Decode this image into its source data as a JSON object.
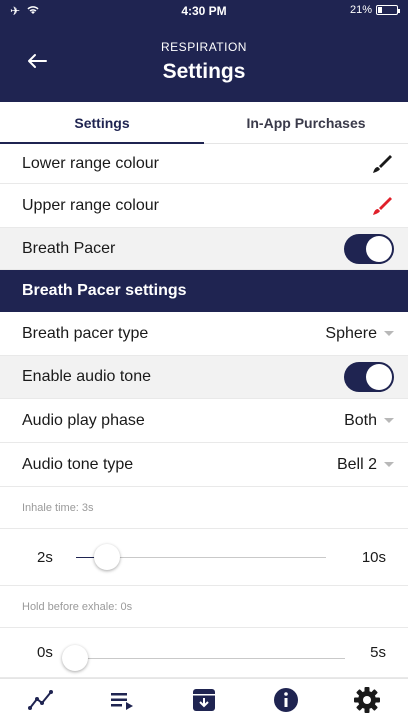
{
  "status_bar": {
    "icons": "✈ ︎",
    "time": "4:30 PM",
    "battery": "21%"
  },
  "header": {
    "subtitle": "RESPIRATION",
    "title": "Settings"
  },
  "tabs": [
    {
      "label": "Settings",
      "active": true
    },
    {
      "label": "In-App Purchases",
      "active": false
    }
  ],
  "settings": {
    "lower_range_colour": {
      "label": "Lower range colour",
      "color": "#1a1a1a"
    },
    "upper_range_colour": {
      "label": "Upper range colour",
      "color": "#e0202a"
    },
    "breath_pacer": {
      "label": "Breath Pacer",
      "on": true
    }
  },
  "pacer_section": {
    "title": "Breath Pacer settings",
    "pacer_type": {
      "label": "Breath pacer type",
      "value": "Sphere"
    },
    "audio_tone": {
      "label": "Enable audio tone",
      "on": true
    },
    "audio_phase": {
      "label": "Audio play phase",
      "value": "Both"
    },
    "tone_type": {
      "label": "Audio tone type",
      "value": "Bell 2"
    },
    "inhale": {
      "caption": "Inhale time: 3s",
      "min": "2s",
      "max": "10s",
      "fraction": 0.125
    },
    "hold": {
      "caption": "Hold before exhale: 0s",
      "min": "0s",
      "max": "5s",
      "fraction": 0.0
    }
  },
  "colors": {
    "primary": "#1f2451",
    "accent_red": "#e0202a"
  },
  "bottom_nav": [
    "chart-icon",
    "playlist-icon",
    "archive-icon",
    "info-icon",
    "gear-icon"
  ]
}
